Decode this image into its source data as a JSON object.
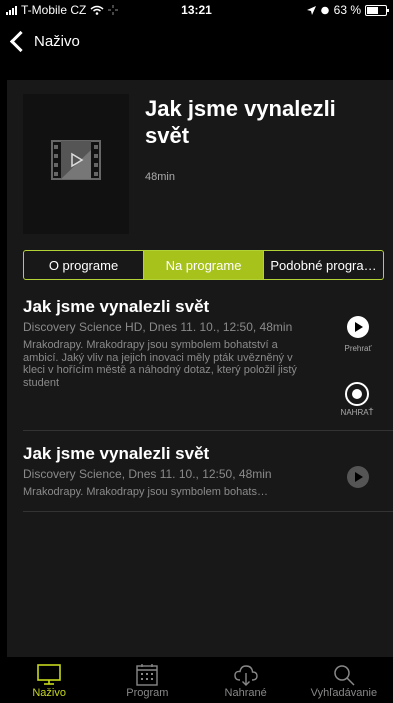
{
  "status": {
    "carrier": "T-Mobile CZ",
    "time": "13:21",
    "battery": "63 %"
  },
  "nav": {
    "back_label": "Naživo"
  },
  "hero": {
    "title": "Jak jsme vynalezli svět",
    "duration": "48min"
  },
  "tabs": [
    {
      "label": "O programe",
      "active": false
    },
    {
      "label": "Na programe",
      "active": true
    },
    {
      "label": "Podobné progra…",
      "active": false
    }
  ],
  "programs": [
    {
      "title": "Jak jsme vynalezli svět",
      "subtitle": "Discovery Science HD, Dnes 11. 10., 12:50, 48min",
      "description": "Mrakodrapy. Mrakodrapy jsou symbolem bohatství a ambicí. Jaký vliv na jejich inovaci měly pták uvězněný v kleci v hořícím městě a náhodný dotaz, který položil jistý student",
      "play_label": "Prehrať",
      "record_label": "NAHRAŤ"
    },
    {
      "title": "Jak jsme vynalezli svět",
      "subtitle": "Discovery Science, Dnes 11. 10., 12:50, 48min",
      "description": "Mrakodrapy. Mrakodrapy jsou symbolem bohats…"
    }
  ],
  "tabbar": [
    {
      "label": "Naživo",
      "icon": "tv-icon",
      "active": true
    },
    {
      "label": "Program",
      "icon": "calendar-icon",
      "active": false
    },
    {
      "label": "Nahrané",
      "icon": "cloud-download-icon",
      "active": false
    },
    {
      "label": "Vyhľadávanie",
      "icon": "search-icon",
      "active": false
    }
  ],
  "colors": {
    "accent": "#a6c21b",
    "tabbar_active": "#c6d71e",
    "panel": "#181818"
  }
}
